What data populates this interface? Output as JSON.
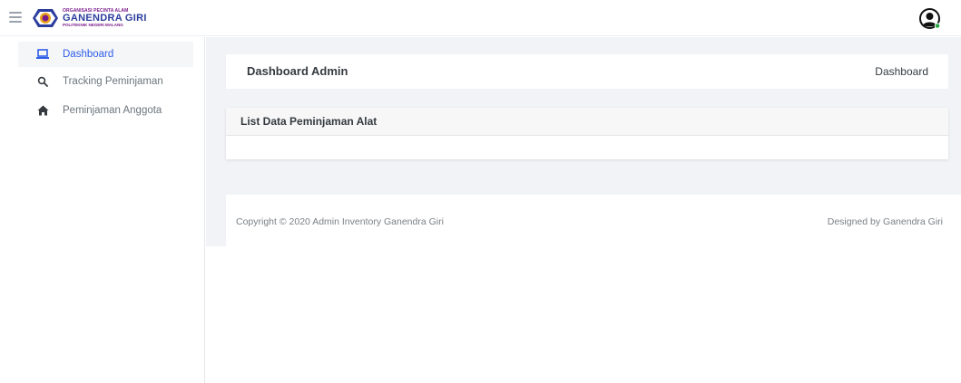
{
  "topbar": {
    "menu_icon": "hamburger-icon",
    "logo": {
      "top_text": "ORGANISASI PECINTA ALAM",
      "main_text": "GANENDRA GIRI",
      "sub_text": "POLITEKNIK NEGERI MALANG"
    },
    "avatar_icon": "user-avatar-icon",
    "online_status_color": "#28a745"
  },
  "sidebar": {
    "items": [
      {
        "label": "Dashboard",
        "icon": "laptop-icon",
        "active": true
      },
      {
        "label": "Tracking Peminjaman",
        "icon": "search-icon",
        "active": false
      },
      {
        "label": "Peminjaman Anggota",
        "icon": "home-icon",
        "active": false
      }
    ]
  },
  "header": {
    "title": "Dashboard Admin",
    "breadcrumb": "Dashboard"
  },
  "list_card": {
    "title": "List Data Peminjaman Alat"
  },
  "footer": {
    "copyright": "Copyright © 2020 Admin Inventory Ganendra Giri",
    "designed_by": "Designed by Ganendra Giri"
  },
  "colors": {
    "accent": "#2f5ee8",
    "content_bg": "#f1f3f6"
  }
}
